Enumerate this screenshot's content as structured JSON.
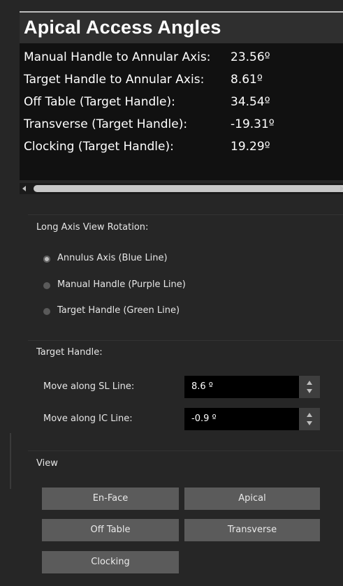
{
  "apical_access": {
    "title": "Apical Access Angles",
    "rows": [
      {
        "label": "Manual Handle to Annular Axis:",
        "value": "23.56º"
      },
      {
        "label": "Target Handle to Annular Axis:",
        "value": "8.61º"
      },
      {
        "label": "Off Table (Target Handle):",
        "value": "34.54º"
      },
      {
        "label": "Transverse (Target Handle):",
        "value": "-19.31º"
      },
      {
        "label": "Clocking (Target Handle):",
        "value": "19.29º"
      }
    ]
  },
  "long_axis": {
    "label": "Long Axis View Rotation:",
    "options": [
      {
        "label": "Annulus Axis (Blue Line)",
        "selected": true
      },
      {
        "label": "Manual Handle (Purple Line)",
        "selected": false
      },
      {
        "label": "Target Handle (Green Line)",
        "selected": false
      }
    ]
  },
  "target_handle": {
    "label": "Target Handle:",
    "fields": [
      {
        "label": "Move along SL Line:",
        "value": "8.6 º"
      },
      {
        "label": "Move along IC Line:",
        "value": "-0.9 º"
      }
    ]
  },
  "view": {
    "label": "View",
    "buttons": [
      "En-Face",
      "Apical",
      "Off Table",
      "Transverse",
      "Clocking"
    ]
  }
}
